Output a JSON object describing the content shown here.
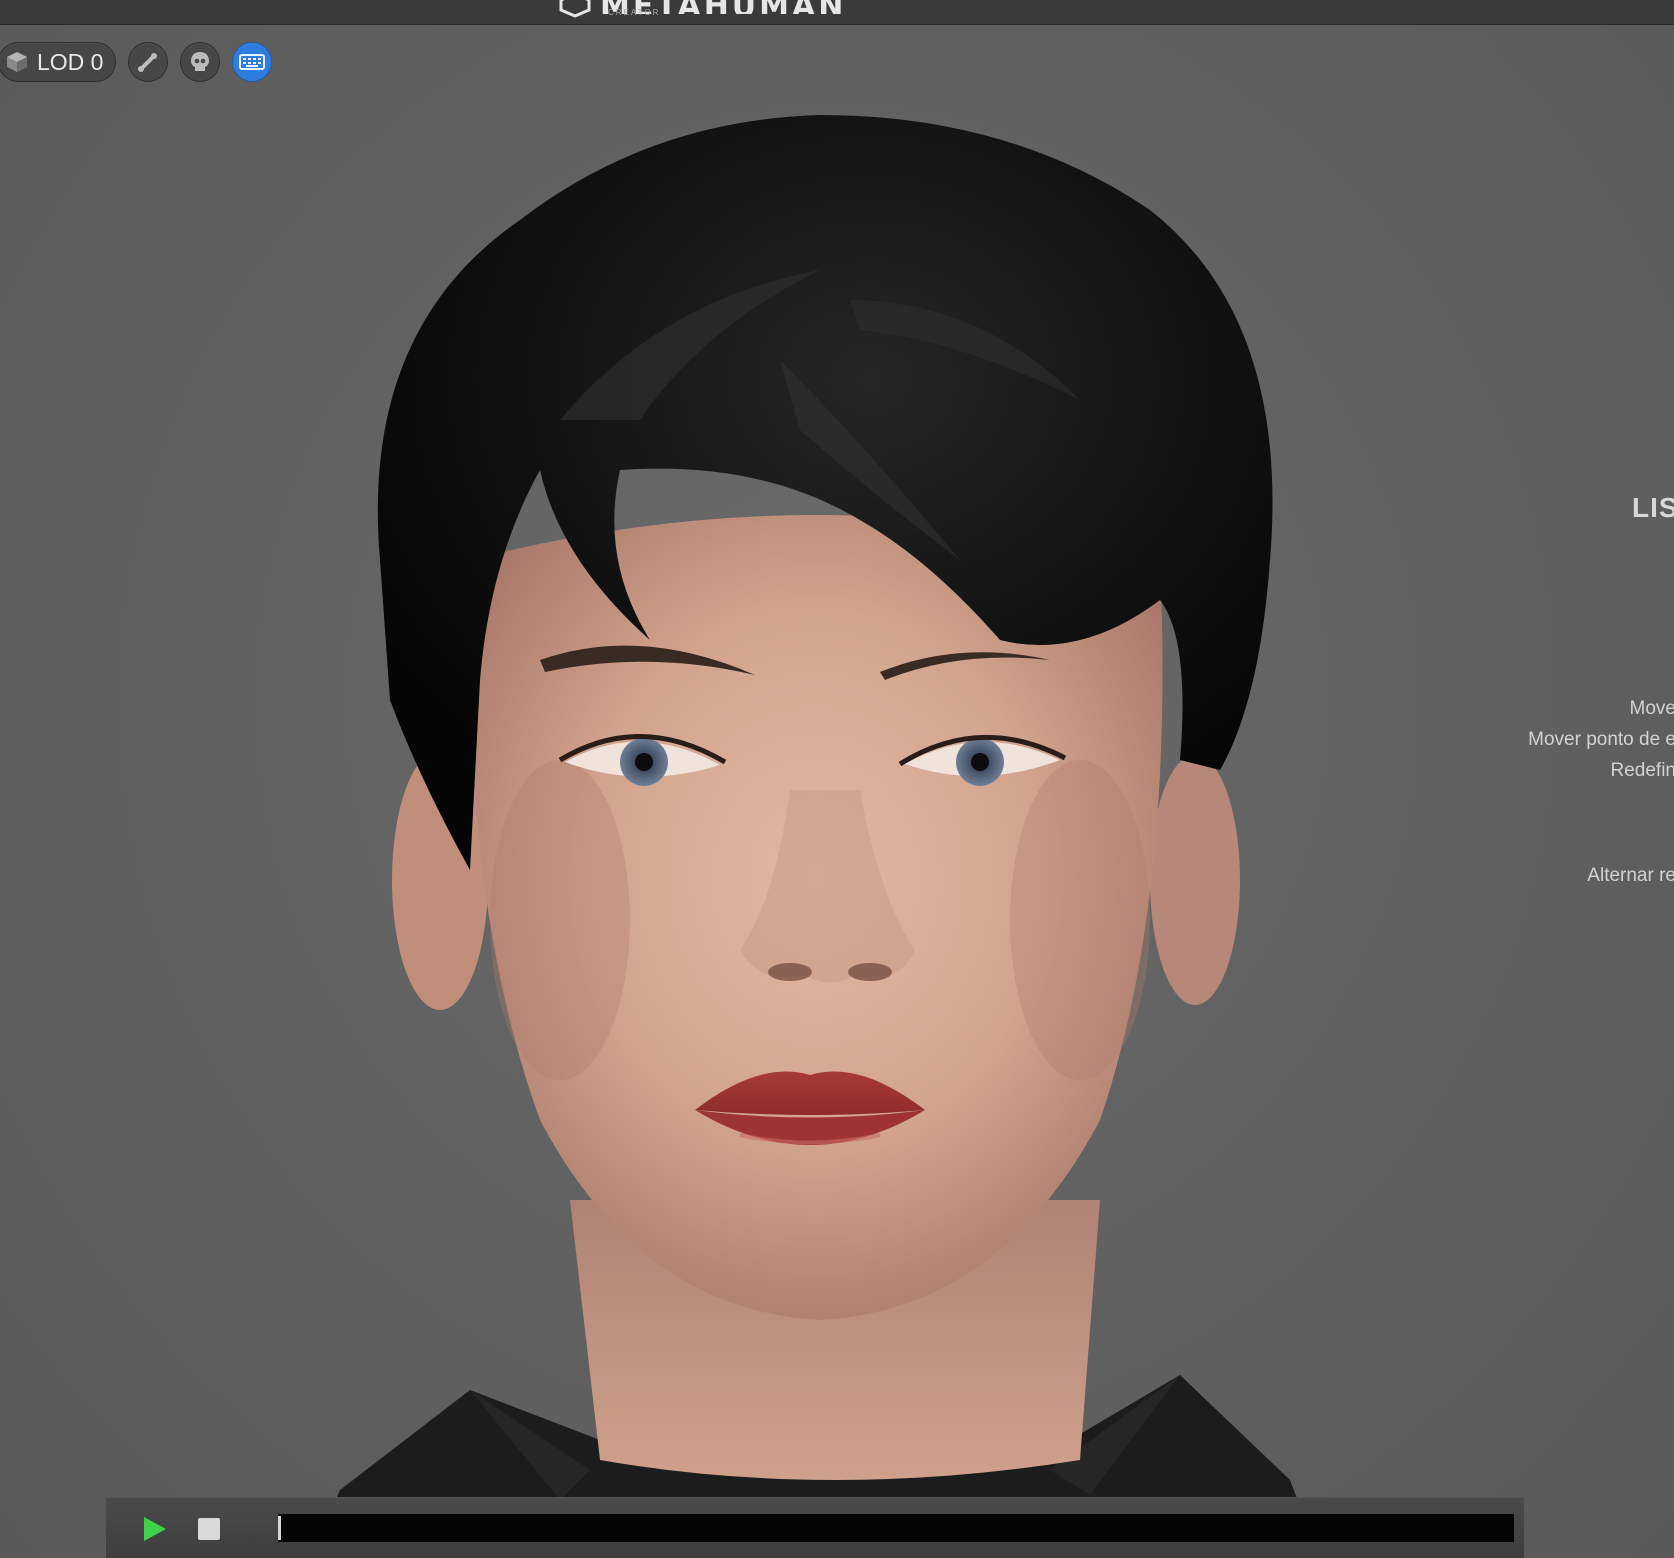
{
  "app": {
    "brand_name": "METAHUMAN",
    "brand_sub": "CREATOR"
  },
  "toolbar": {
    "lod_label": "LOD 0",
    "buttons": [
      {
        "icon": "bone-icon",
        "active": false
      },
      {
        "icon": "skull-icon",
        "active": false
      },
      {
        "icon": "keyboard-icon",
        "active": true
      }
    ],
    "accent_color": "#2f7ce0"
  },
  "viewport": {
    "subject": "female-character-head-short-black-hair"
  },
  "help_overlay": {
    "title": "LIS",
    "lines": [
      "Move",
      "Mover ponto de e",
      "Redefin",
      "Alternar re"
    ]
  },
  "playback": {
    "play_icon": "play-icon",
    "stop_icon": "stop-icon",
    "play_color": "#3fd14a",
    "progress": 0
  }
}
